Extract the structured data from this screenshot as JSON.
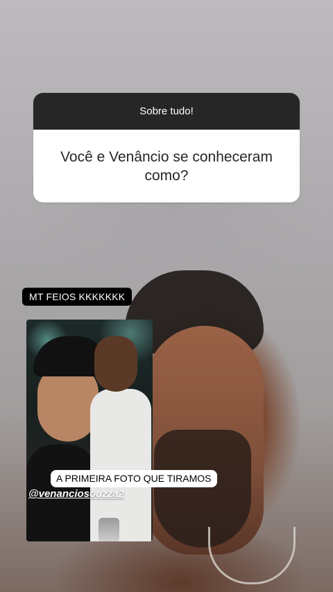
{
  "question_sticker": {
    "header": "Sobre tudo!",
    "question": "Você e Venâncio se conheceram como?"
  },
  "answer": {
    "text": "MT FEIOS KKKKKKK"
  },
  "photo": {
    "caption": "A PRIMEIRA FOTO QUE TIRAMOS",
    "mention": "@venanciosouzza2"
  },
  "colors": {
    "sticker_header": "#262626",
    "sticker_body": "#ffffff",
    "answer_pill": "#000000"
  }
}
